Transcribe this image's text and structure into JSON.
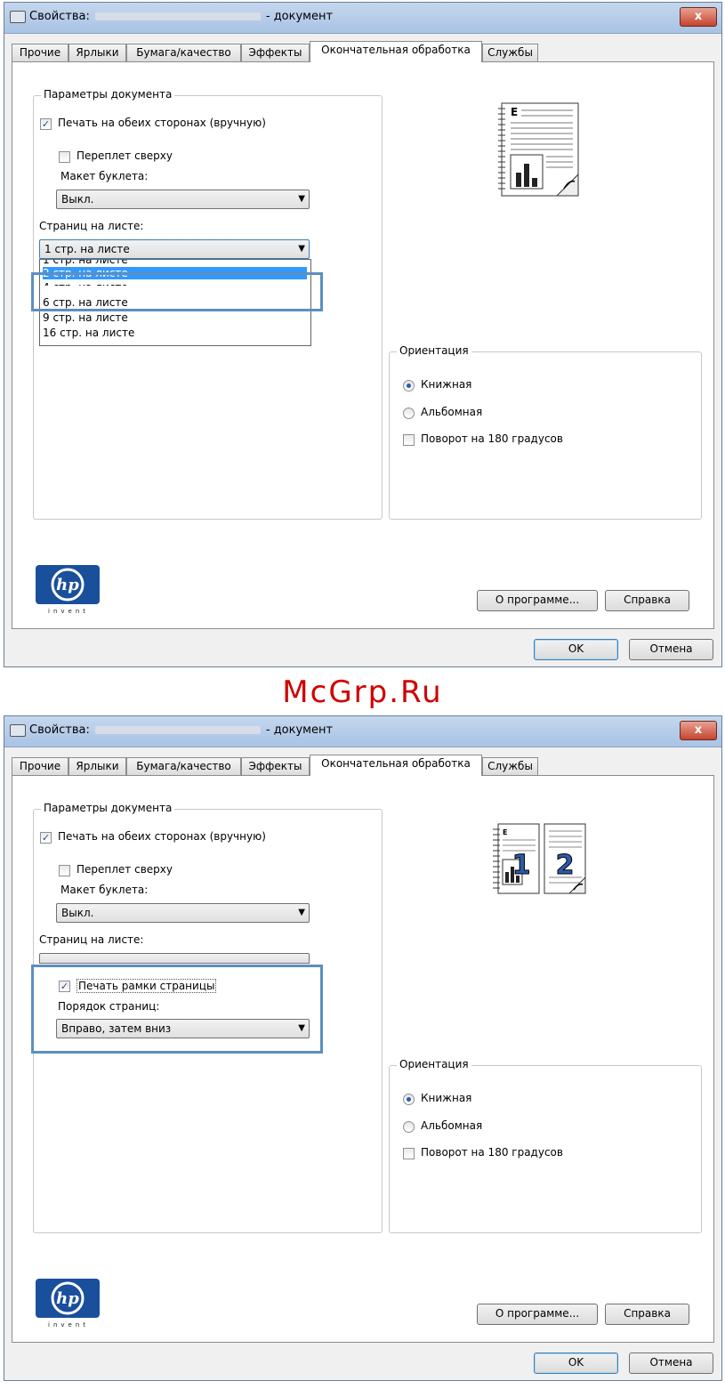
{
  "watermark": "McGrp.Ru",
  "dialogs": [
    {
      "title_prefix": "Свойства:",
      "title_suffix": "- документ",
      "close_label": "x",
      "tabs": [
        "Прочие",
        "Ярлыки",
        "Бумага/качество",
        "Эффекты",
        "Окончательная обработка",
        "Службы"
      ],
      "doc_options_label": "Параметры документа",
      "duplex_label": "Печать на обеих сторонах (вручную)",
      "binding_label": "Переплет сверху",
      "booklet_label": "Макет буклета:",
      "booklet_value": "Выкл.",
      "pages_per_sheet_label": "Страниц на листе:",
      "pages_per_sheet_value": "1 стр. на листе",
      "dropdown_items": [
        "1 стр. на листе",
        "2 стр. на листе",
        "4 стр. на листе",
        "6 стр. на листе",
        "9 стр. на листе",
        "16 стр. на листе"
      ],
      "orientation_label": "Ориентация",
      "portrait_label": "Книжная",
      "landscape_label": "Альбомная",
      "rotate_label": "Поворот на 180 градусов",
      "about_button": "О программе...",
      "help_button": "Справка",
      "ok_button": "OK",
      "cancel_button": "Отмена",
      "logo_text": "invent"
    },
    {
      "title_prefix": "Свойства:",
      "title_suffix": "- документ",
      "close_label": "x",
      "tabs": [
        "Прочие",
        "Ярлыки",
        "Бумага/качество",
        "Эффекты",
        "Окончательная обработка",
        "Службы"
      ],
      "doc_options_label": "Параметры документа",
      "duplex_label": "Печать на обеих сторонах (вручную)",
      "binding_label": "Переплет сверху",
      "booklet_label": "Макет буклета:",
      "booklet_value": "Выкл.",
      "pages_per_sheet_label": "Страниц на листе:",
      "print_borders_label": "Печать рамки страницы",
      "page_order_label": "Порядок страниц:",
      "page_order_value": "Вправо, затем вниз",
      "orientation_label": "Ориентация",
      "portrait_label": "Книжная",
      "landscape_label": "Альбомная",
      "rotate_label": "Поворот на 180 градусов",
      "about_button": "О программе...",
      "help_button": "Справка",
      "ok_button": "OK",
      "cancel_button": "Отмена",
      "logo_text": "invent",
      "preview_pages": [
        "1",
        "2"
      ]
    }
  ]
}
